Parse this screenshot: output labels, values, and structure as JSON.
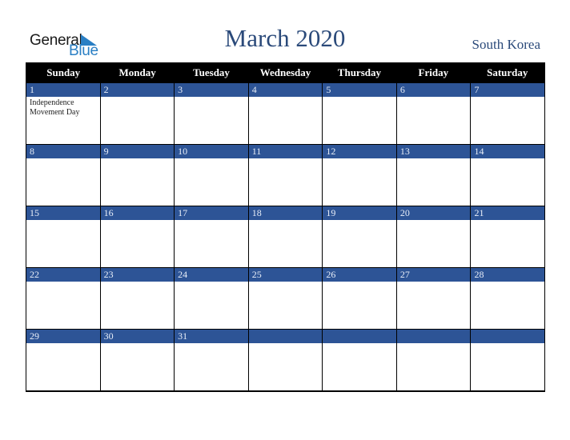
{
  "logo": {
    "line1": "General",
    "line2": "Blue"
  },
  "header": {
    "title": "March 2020",
    "country": "South Korea"
  },
  "colors": {
    "header_bg": "#000000",
    "day_bar": "#2d5496",
    "title": "#2b4a7a",
    "logo_blue": "#2a7fc4"
  },
  "weekdays": [
    "Sunday",
    "Monday",
    "Tuesday",
    "Wednesday",
    "Thursday",
    "Friday",
    "Saturday"
  ],
  "weeks": [
    [
      {
        "day": "1",
        "event": "Independence Movement Day"
      },
      {
        "day": "2",
        "event": ""
      },
      {
        "day": "3",
        "event": ""
      },
      {
        "day": "4",
        "event": ""
      },
      {
        "day": "5",
        "event": ""
      },
      {
        "day": "6",
        "event": ""
      },
      {
        "day": "7",
        "event": ""
      }
    ],
    [
      {
        "day": "8",
        "event": ""
      },
      {
        "day": "9",
        "event": ""
      },
      {
        "day": "10",
        "event": ""
      },
      {
        "day": "11",
        "event": ""
      },
      {
        "day": "12",
        "event": ""
      },
      {
        "day": "13",
        "event": ""
      },
      {
        "day": "14",
        "event": ""
      }
    ],
    [
      {
        "day": "15",
        "event": ""
      },
      {
        "day": "16",
        "event": ""
      },
      {
        "day": "17",
        "event": ""
      },
      {
        "day": "18",
        "event": ""
      },
      {
        "day": "19",
        "event": ""
      },
      {
        "day": "20",
        "event": ""
      },
      {
        "day": "21",
        "event": ""
      }
    ],
    [
      {
        "day": "22",
        "event": ""
      },
      {
        "day": "23",
        "event": ""
      },
      {
        "day": "24",
        "event": ""
      },
      {
        "day": "25",
        "event": ""
      },
      {
        "day": "26",
        "event": ""
      },
      {
        "day": "27",
        "event": ""
      },
      {
        "day": "28",
        "event": ""
      }
    ],
    [
      {
        "day": "29",
        "event": ""
      },
      {
        "day": "30",
        "event": ""
      },
      {
        "day": "31",
        "event": ""
      },
      {
        "day": "",
        "event": ""
      },
      {
        "day": "",
        "event": ""
      },
      {
        "day": "",
        "event": ""
      },
      {
        "day": "",
        "event": ""
      }
    ]
  ]
}
